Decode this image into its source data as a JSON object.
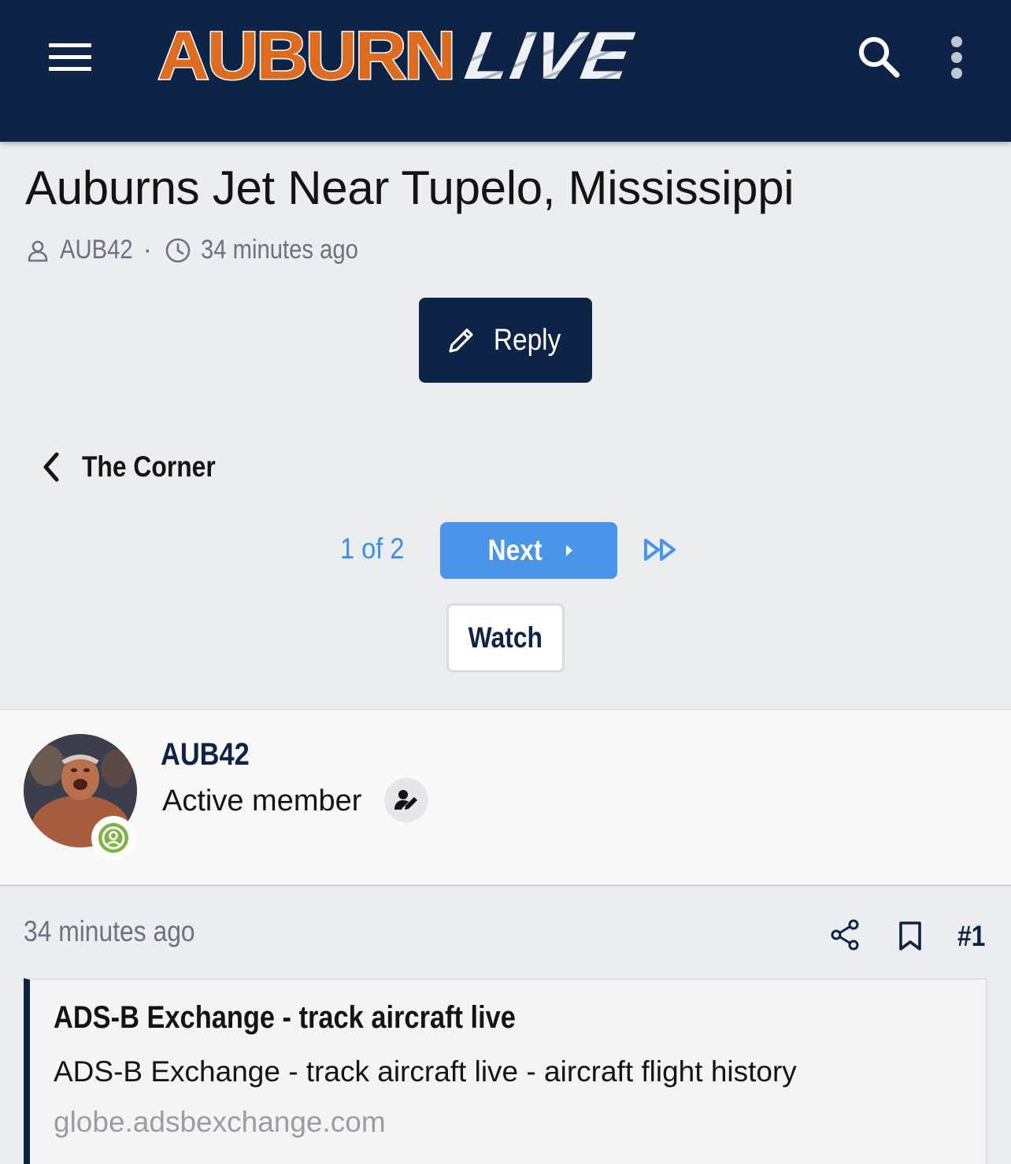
{
  "header": {
    "logo_primary": "AUBURN",
    "logo_secondary": "LIVE",
    "icons": [
      "menu-icon",
      "search-icon",
      "more-vertical-icon"
    ]
  },
  "thread": {
    "title": "Auburns Jet Near Tupelo, Mississippi",
    "author": "AUB42",
    "separator": "·",
    "time": "34 minutes ago",
    "reply_label": "Reply",
    "breadcrumb_label": "The Corner",
    "pagination": {
      "current_label": "1 of 2",
      "next_label": "Next"
    },
    "watch_label": "Watch"
  },
  "post": {
    "username": "AUB42",
    "user_title": "Active member",
    "time": "34 minutes ago",
    "number": "#1",
    "link_preview": {
      "title": "ADS-B Exchange - track aircraft live",
      "description": "ADS-B Exchange - track aircraft live - aircraft flight history",
      "domain": "globe.adsbexchange.com"
    }
  },
  "colors": {
    "navy": "#0d2446",
    "orange": "#dd6b20",
    "link_blue": "#4a94ea",
    "online_green": "#7cb342",
    "page_bg": "#ecedf0"
  }
}
